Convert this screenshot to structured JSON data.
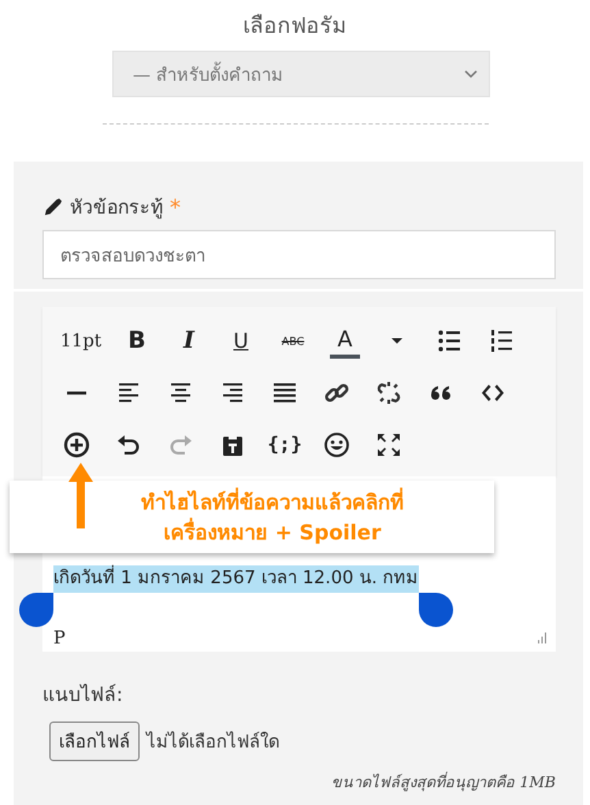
{
  "forum_picker": {
    "title": "เลือกฟอรัม",
    "select_value": "— สำหรับตั้งคำถาม"
  },
  "subject": {
    "label": "หัวข้อกระทู้",
    "required_mark": "*",
    "value": "ตรวจสอบดวงชะตา"
  },
  "toolbar": {
    "rows": [
      [
        {
          "kind": "fontsize",
          "label": "11pt"
        },
        {
          "kind": "bold",
          "label": "B"
        },
        {
          "kind": "italic",
          "label": "I"
        },
        {
          "kind": "underline",
          "label": "U"
        },
        {
          "kind": "strike",
          "label": "ABC"
        },
        {
          "kind": "color",
          "label": "A",
          "color": "#4a525a"
        },
        {
          "kind": "caret"
        },
        {
          "kind": "bullets"
        },
        {
          "kind": "numbers"
        }
      ],
      [
        {
          "kind": "hr"
        },
        {
          "kind": "align-left"
        },
        {
          "kind": "align-center"
        },
        {
          "kind": "align-right"
        },
        {
          "kind": "justify"
        },
        {
          "kind": "link"
        },
        {
          "kind": "unlink"
        },
        {
          "kind": "quote"
        },
        {
          "kind": "code"
        }
      ],
      [
        {
          "kind": "plus"
        },
        {
          "kind": "undo"
        },
        {
          "kind": "redo",
          "disabled": true
        },
        {
          "kind": "paste"
        },
        {
          "kind": "braces",
          "label": "{;}"
        },
        {
          "kind": "smiley"
        },
        {
          "kind": "fullscreen"
        }
      ]
    ]
  },
  "callout": {
    "lines": [
      "ทำไฮไลท์ที่ข้อความแล้วคลิกที่",
      "เครื่องหมาย + Spoiler"
    ]
  },
  "editor": {
    "text": "เกิดวันที่ 1 มกราคม 2567 เวลา 12.00 น. กทม",
    "selected": true,
    "path": "P"
  },
  "attachment": {
    "label": "แนบไฟล์:",
    "button": "เลือกไฟล์",
    "status": "ไม่ได้เลือกไฟล์ใด",
    "note": "ขนาดไฟล์สูงสุดที่อนุญาตคือ 1MB"
  }
}
